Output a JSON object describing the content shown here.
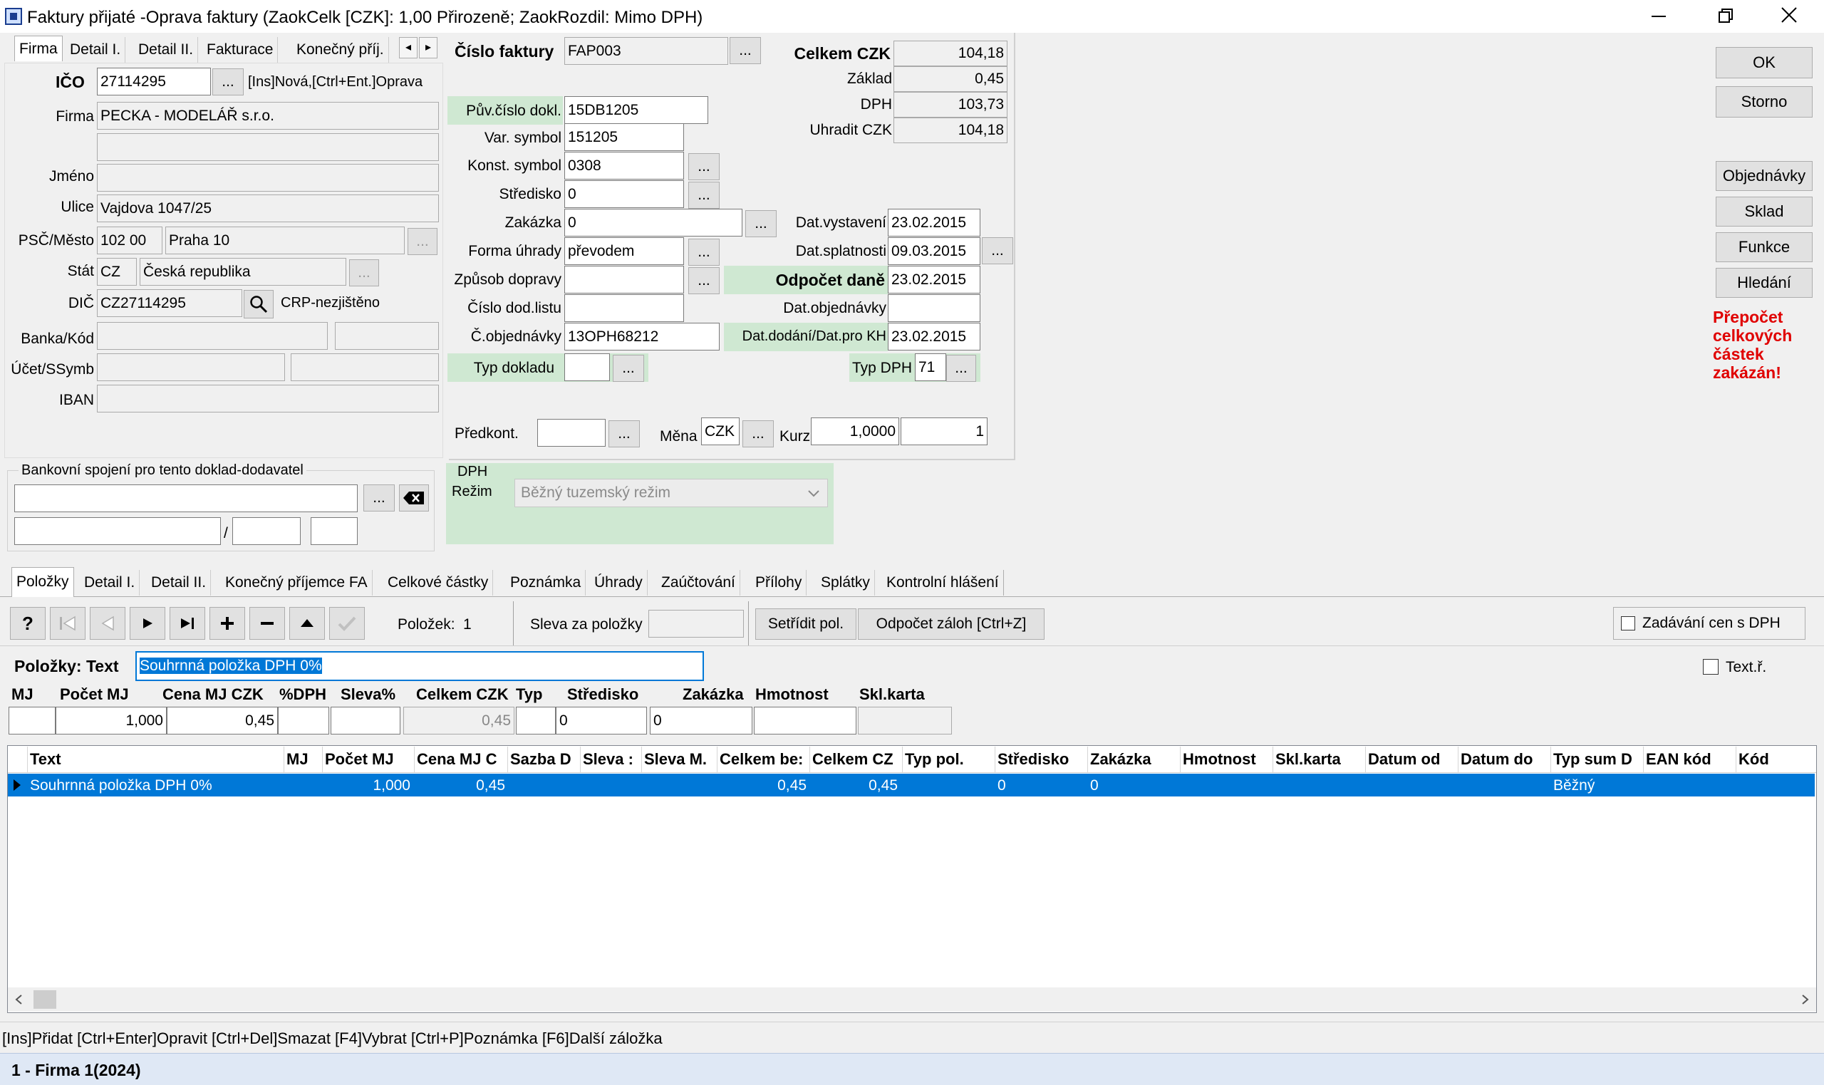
{
  "window": {
    "title": "Faktury přijaté -Oprava faktury  (ZaokCelk [CZK]: 1,00 Přirozeně; ZaokRozdil: Mimo DPH)"
  },
  "left_tabs": [
    "Firma",
    "Detail I.",
    "Detail II.",
    "Fakturace",
    "Konečný příj."
  ],
  "firma": {
    "ico_label": "IČO",
    "ico": "27114295",
    "ico_hint": "[Ins]Nová,[Ctrl+Ent.]Oprava",
    "firma_label": "Firma",
    "firma": "PECKA - MODELÁŘ s.r.o.",
    "jmeno_label": "Jméno",
    "ulice_label": "Ulice",
    "ulice": "Vajdova 1047/25",
    "psc_label": "PSČ/Město",
    "psc": "102 00",
    "mesto": "Praha 10",
    "stat_label": "Stát",
    "stat_code": "CZ",
    "stat": "Česká republika",
    "dic_label": "DIČ",
    "dic": "CZ27114295",
    "dic_status": "CRP-nezjištěno",
    "banka_label": "Banka/Kód",
    "ucet_label": "Účet/SSymb",
    "iban_label": "IBAN"
  },
  "bank": {
    "legend": "Bankovní spojení pro tento doklad-dodavatel",
    "slash": "/"
  },
  "doc": {
    "cislo_label": "Číslo faktury",
    "cislo": "FAP003",
    "puv_label": "Pův.číslo dokl.",
    "puv": "15DB1205",
    "var_label": "Var. symbol",
    "var": "151205",
    "konst_label": "Konst. symbol",
    "konst": "0308",
    "stredisko_label": "Středisko",
    "stredisko": "0",
    "zakazka_label": "Zakázka",
    "zakazka": "0",
    "forma_label": "Forma úhrady",
    "forma": "převodem",
    "doprava_label": "Způsob dopravy",
    "dodlist_label": "Číslo dod.listu",
    "objednavky_label": "Č.objednávky",
    "objednavky": "13OPH68212",
    "typdokl_label": "Typ dokladu",
    "predkont_label": "Předkont.",
    "mena_label": "Měna",
    "mena": "CZK",
    "kurz_label": "Kurz",
    "kurz": "1,0000",
    "kurz_qty": "1",
    "dph_label": "DPH",
    "rezim_label": "Režim",
    "rezim": "Běžný tuzemský režim"
  },
  "totals": {
    "celkem_label": "Celkem CZK",
    "celkem": "104,18",
    "zaklad_label": "Základ",
    "zaklad": "0,45",
    "dph_label": "DPH",
    "dph": "103,73",
    "uhradit_label": "Uhradit CZK",
    "uhradit": "104,18"
  },
  "dates": {
    "vystaveni_label": "Dat.vystavení",
    "vystaveni": "23.02.2015",
    "splatnosti_label": "Dat.splatnosti",
    "splatnosti": "09.03.2015",
    "odpocet_label": "Odpočet daně",
    "odpocet": "23.02.2015",
    "objednavky_label": "Dat.objednávky",
    "dodani_label": "Dat.dodání/Dat.pro KH",
    "dodani": "23.02.2015",
    "typdph_label": "Typ DPH",
    "typdph": "71"
  },
  "right_buttons": {
    "ok": "OK",
    "storno": "Storno",
    "objednavky": "Objednávky",
    "sklad": "Sklad",
    "funkce": "Funkce",
    "hledani": "Hledání"
  },
  "warning": [
    "Přepočet",
    "celkových",
    "částek",
    "zakázán!"
  ],
  "bottom_tabs": [
    "Položky",
    "Detail I.",
    "Detail II.",
    "Konečný příjemce FA",
    "Celkové částky",
    "Poznámka",
    "Úhrady",
    "Zaúčtování",
    "Přílohy",
    "Splátky",
    "Kontrolní hlášení"
  ],
  "toolbar": {
    "help": "?",
    "polozek_label": "Položek:",
    "polozek": "1",
    "sleva_label": "Sleva za položky",
    "setridit": "Setřídit pol.",
    "odpocet_zaloh": "Odpočet záloh [Ctrl+Z]",
    "zadavani": "Zadávání cen s DPH"
  },
  "edit": {
    "text_label": "Položky: Text",
    "text": "Souhrnná položka DPH 0%",
    "textr_label": "Text.ř.",
    "headers": [
      "MJ",
      "Počet MJ",
      "Cena MJ CZK",
      "%DPH",
      "Sleva%",
      "Celkem CZK",
      "Typ",
      "Středisko",
      "Zakázka",
      "Hmotnost",
      "Skl.karta"
    ],
    "pocet": "1,000",
    "cena": "0,45",
    "celkem": "0,45",
    "stredisko": "0",
    "zakazka": "0"
  },
  "grid": {
    "headers": [
      "Text",
      "MJ",
      "Počet MJ",
      "Cena MJ C",
      "Sazba D",
      "Sleva :",
      "Sleva M.",
      "Celkem be:",
      "Celkem CZ",
      "Typ pol.",
      "Středisko",
      "Zakázka",
      "Hmotnost",
      "Skl.karta",
      "Datum od",
      "Datum do",
      "Typ sum D",
      "EAN kód",
      "Kód"
    ],
    "row": {
      "text": "Souhrnná položka DPH 0%",
      "pocet": "1,000",
      "cena": "0,45",
      "celkem_bez": "0,45",
      "celkem": "0,45",
      "stredisko": "0",
      "zakazka": "0",
      "typ_sum": "Běžný"
    }
  },
  "status": {
    "hints": "[Ins]Přidat [Ctrl+Enter]Opravit [Ctrl+Del]Smazat [F4]Vybrat [Ctrl+P]Poznámka [F6]Další záložka",
    "firm": "1 - Firma 1(2024)"
  },
  "colors": {
    "selection": "#0078d7",
    "warning": "#e00000",
    "green_label": "#cfe8d2"
  }
}
